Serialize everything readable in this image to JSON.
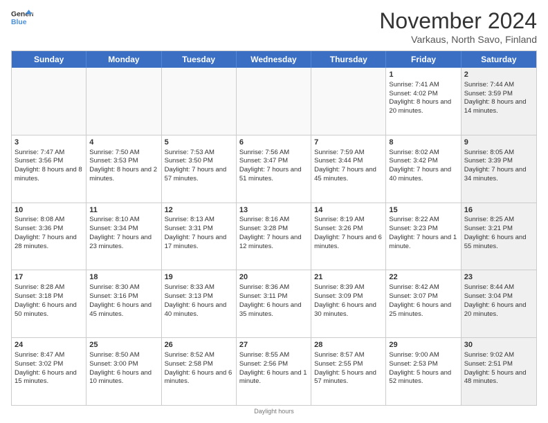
{
  "logo": {
    "line1": "General",
    "line2": "Blue"
  },
  "title": "November 2024",
  "subtitle": "Varkaus, North Savo, Finland",
  "days_of_week": [
    "Sunday",
    "Monday",
    "Tuesday",
    "Wednesday",
    "Thursday",
    "Friday",
    "Saturday"
  ],
  "footer": "Daylight hours",
  "weeks": [
    [
      {
        "day": "",
        "info": "",
        "shaded": false,
        "empty": true
      },
      {
        "day": "",
        "info": "",
        "shaded": false,
        "empty": true
      },
      {
        "day": "",
        "info": "",
        "shaded": false,
        "empty": true
      },
      {
        "day": "",
        "info": "",
        "shaded": false,
        "empty": true
      },
      {
        "day": "",
        "info": "",
        "shaded": false,
        "empty": true
      },
      {
        "day": "1",
        "info": "Sunrise: 7:41 AM\nSunset: 4:02 PM\nDaylight: 8 hours and 20 minutes.",
        "shaded": false,
        "empty": false
      },
      {
        "day": "2",
        "info": "Sunrise: 7:44 AM\nSunset: 3:59 PM\nDaylight: 8 hours and 14 minutes.",
        "shaded": true,
        "empty": false
      }
    ],
    [
      {
        "day": "3",
        "info": "Sunrise: 7:47 AM\nSunset: 3:56 PM\nDaylight: 8 hours and 8 minutes.",
        "shaded": false,
        "empty": false
      },
      {
        "day": "4",
        "info": "Sunrise: 7:50 AM\nSunset: 3:53 PM\nDaylight: 8 hours and 2 minutes.",
        "shaded": false,
        "empty": false
      },
      {
        "day": "5",
        "info": "Sunrise: 7:53 AM\nSunset: 3:50 PM\nDaylight: 7 hours and 57 minutes.",
        "shaded": false,
        "empty": false
      },
      {
        "day": "6",
        "info": "Sunrise: 7:56 AM\nSunset: 3:47 PM\nDaylight: 7 hours and 51 minutes.",
        "shaded": false,
        "empty": false
      },
      {
        "day": "7",
        "info": "Sunrise: 7:59 AM\nSunset: 3:44 PM\nDaylight: 7 hours and 45 minutes.",
        "shaded": false,
        "empty": false
      },
      {
        "day": "8",
        "info": "Sunrise: 8:02 AM\nSunset: 3:42 PM\nDaylight: 7 hours and 40 minutes.",
        "shaded": false,
        "empty": false
      },
      {
        "day": "9",
        "info": "Sunrise: 8:05 AM\nSunset: 3:39 PM\nDaylight: 7 hours and 34 minutes.",
        "shaded": true,
        "empty": false
      }
    ],
    [
      {
        "day": "10",
        "info": "Sunrise: 8:08 AM\nSunset: 3:36 PM\nDaylight: 7 hours and 28 minutes.",
        "shaded": false,
        "empty": false
      },
      {
        "day": "11",
        "info": "Sunrise: 8:10 AM\nSunset: 3:34 PM\nDaylight: 7 hours and 23 minutes.",
        "shaded": false,
        "empty": false
      },
      {
        "day": "12",
        "info": "Sunrise: 8:13 AM\nSunset: 3:31 PM\nDaylight: 7 hours and 17 minutes.",
        "shaded": false,
        "empty": false
      },
      {
        "day": "13",
        "info": "Sunrise: 8:16 AM\nSunset: 3:28 PM\nDaylight: 7 hours and 12 minutes.",
        "shaded": false,
        "empty": false
      },
      {
        "day": "14",
        "info": "Sunrise: 8:19 AM\nSunset: 3:26 PM\nDaylight: 7 hours and 6 minutes.",
        "shaded": false,
        "empty": false
      },
      {
        "day": "15",
        "info": "Sunrise: 8:22 AM\nSunset: 3:23 PM\nDaylight: 7 hours and 1 minute.",
        "shaded": false,
        "empty": false
      },
      {
        "day": "16",
        "info": "Sunrise: 8:25 AM\nSunset: 3:21 PM\nDaylight: 6 hours and 55 minutes.",
        "shaded": true,
        "empty": false
      }
    ],
    [
      {
        "day": "17",
        "info": "Sunrise: 8:28 AM\nSunset: 3:18 PM\nDaylight: 6 hours and 50 minutes.",
        "shaded": false,
        "empty": false
      },
      {
        "day": "18",
        "info": "Sunrise: 8:30 AM\nSunset: 3:16 PM\nDaylight: 6 hours and 45 minutes.",
        "shaded": false,
        "empty": false
      },
      {
        "day": "19",
        "info": "Sunrise: 8:33 AM\nSunset: 3:13 PM\nDaylight: 6 hours and 40 minutes.",
        "shaded": false,
        "empty": false
      },
      {
        "day": "20",
        "info": "Sunrise: 8:36 AM\nSunset: 3:11 PM\nDaylight: 6 hours and 35 minutes.",
        "shaded": false,
        "empty": false
      },
      {
        "day": "21",
        "info": "Sunrise: 8:39 AM\nSunset: 3:09 PM\nDaylight: 6 hours and 30 minutes.",
        "shaded": false,
        "empty": false
      },
      {
        "day": "22",
        "info": "Sunrise: 8:42 AM\nSunset: 3:07 PM\nDaylight: 6 hours and 25 minutes.",
        "shaded": false,
        "empty": false
      },
      {
        "day": "23",
        "info": "Sunrise: 8:44 AM\nSunset: 3:04 PM\nDaylight: 6 hours and 20 minutes.",
        "shaded": true,
        "empty": false
      }
    ],
    [
      {
        "day": "24",
        "info": "Sunrise: 8:47 AM\nSunset: 3:02 PM\nDaylight: 6 hours and 15 minutes.",
        "shaded": false,
        "empty": false
      },
      {
        "day": "25",
        "info": "Sunrise: 8:50 AM\nSunset: 3:00 PM\nDaylight: 6 hours and 10 minutes.",
        "shaded": false,
        "empty": false
      },
      {
        "day": "26",
        "info": "Sunrise: 8:52 AM\nSunset: 2:58 PM\nDaylight: 6 hours and 6 minutes.",
        "shaded": false,
        "empty": false
      },
      {
        "day": "27",
        "info": "Sunrise: 8:55 AM\nSunset: 2:56 PM\nDaylight: 6 hours and 1 minute.",
        "shaded": false,
        "empty": false
      },
      {
        "day": "28",
        "info": "Sunrise: 8:57 AM\nSunset: 2:55 PM\nDaylight: 5 hours and 57 minutes.",
        "shaded": false,
        "empty": false
      },
      {
        "day": "29",
        "info": "Sunrise: 9:00 AM\nSunset: 2:53 PM\nDaylight: 5 hours and 52 minutes.",
        "shaded": false,
        "empty": false
      },
      {
        "day": "30",
        "info": "Sunrise: 9:02 AM\nSunset: 2:51 PM\nDaylight: 5 hours and 48 minutes.",
        "shaded": true,
        "empty": false
      }
    ]
  ]
}
